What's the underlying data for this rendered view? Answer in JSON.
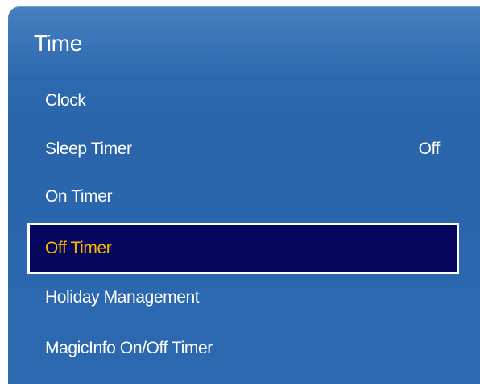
{
  "menu": {
    "title": "Time",
    "items": [
      {
        "label": "Clock",
        "value": ""
      },
      {
        "label": "Sleep Timer",
        "value": "Off"
      },
      {
        "label": "On Timer",
        "value": ""
      },
      {
        "label": "Off Timer",
        "value": "",
        "selected": true
      },
      {
        "label": "Holiday Management",
        "value": ""
      },
      {
        "label": "MagicInfo On/Off Timer",
        "value": ""
      }
    ]
  },
  "colors": {
    "panel": "#2c69b1",
    "selected_background": "#04075c",
    "selected_text": "#ffb400",
    "text": "#ffffff"
  }
}
